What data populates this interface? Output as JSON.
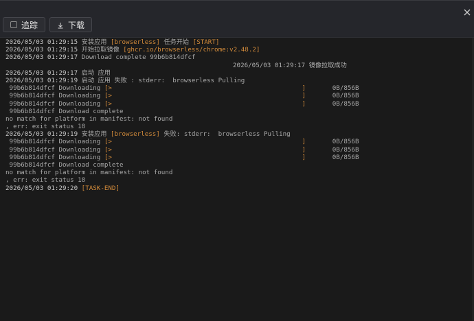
{
  "toolbar": {
    "follow_label": "追踪",
    "download_label": "下载"
  },
  "log": {
    "lines": [
      {
        "ts": "2026/05/03 01:29:15",
        "parts": [
          {
            "t": " 安装应用 ",
            "c": "msg"
          },
          {
            "t": "[browserless]",
            "c": "hl"
          },
          {
            "t": " 任务开始 ",
            "c": "msg"
          },
          {
            "t": "[START]",
            "c": "hl"
          }
        ]
      },
      {
        "ts": "2026/05/03 01:29:15",
        "parts": [
          {
            "t": " 开始拉取镜像 ",
            "c": "msg"
          },
          {
            "t": "[ghcr.io/browserless/chrome:v2.48.2]",
            "c": "hl"
          }
        ]
      },
      {
        "ts": "2026/05/03 01:29:17",
        "parts": [
          {
            "t": " Download complete 99b6b814dfcf",
            "c": "msg"
          }
        ]
      },
      {
        "right": "2026/05/03 01:29:17 镜像拉取成功"
      },
      {
        "ts": "2026/05/03 01:29:17",
        "parts": [
          {
            "t": " 启动 应用",
            "c": "msg"
          }
        ]
      },
      {
        "ts": "2026/05/03 01:29:19",
        "parts": [
          {
            "t": " 启动 应用 失败 : stderr:  browserless Pulling",
            "c": "msg"
          }
        ]
      },
      {
        "ts": "",
        "parts": [
          {
            "t": " 99b6b814dfcf Downloading ",
            "c": "msg"
          },
          {
            "t": "[>",
            "c": "hl"
          },
          {
            "t": "                                                  ",
            "c": "msg"
          },
          {
            "t": "]",
            "c": "hl"
          },
          {
            "t": "       0B/856B",
            "c": "msg"
          }
        ]
      },
      {
        "ts": "",
        "parts": [
          {
            "t": " 99b6b814dfcf Downloading ",
            "c": "msg"
          },
          {
            "t": "[>",
            "c": "hl"
          },
          {
            "t": "                                                  ",
            "c": "msg"
          },
          {
            "t": "]",
            "c": "hl"
          },
          {
            "t": "       0B/856B",
            "c": "msg"
          }
        ]
      },
      {
        "ts": "",
        "parts": [
          {
            "t": " 99b6b814dfcf Downloading ",
            "c": "msg"
          },
          {
            "t": "[>",
            "c": "hl"
          },
          {
            "t": "                                                  ",
            "c": "msg"
          },
          {
            "t": "]",
            "c": "hl"
          },
          {
            "t": "       0B/856B",
            "c": "msg"
          }
        ]
      },
      {
        "ts": "",
        "parts": [
          {
            "t": " 99b6b814dfcf Download complete",
            "c": "msg"
          }
        ]
      },
      {
        "ts": "",
        "parts": [
          {
            "t": "no match for platform in manifest: not found",
            "c": "msg"
          }
        ]
      },
      {
        "ts": "",
        "parts": [
          {
            "t": ", err: exit status 18",
            "c": "msg"
          }
        ]
      },
      {
        "ts": "2026/05/03 01:29:19",
        "parts": [
          {
            "t": " 安装应用 ",
            "c": "msg"
          },
          {
            "t": "[browserless]",
            "c": "hl"
          },
          {
            "t": " 失败: stderr:  browserless Pulling",
            "c": "msg"
          }
        ]
      },
      {
        "ts": "",
        "parts": [
          {
            "t": " 99b6b814dfcf Downloading ",
            "c": "msg"
          },
          {
            "t": "[>",
            "c": "hl"
          },
          {
            "t": "                                                  ",
            "c": "msg"
          },
          {
            "t": "]",
            "c": "hl"
          },
          {
            "t": "       0B/856B",
            "c": "msg"
          }
        ]
      },
      {
        "ts": "",
        "parts": [
          {
            "t": " 99b6b814dfcf Downloading ",
            "c": "msg"
          },
          {
            "t": "[>",
            "c": "hl"
          },
          {
            "t": "                                                  ",
            "c": "msg"
          },
          {
            "t": "]",
            "c": "hl"
          },
          {
            "t": "       0B/856B",
            "c": "msg"
          }
        ]
      },
      {
        "ts": "",
        "parts": [
          {
            "t": " 99b6b814dfcf Downloading ",
            "c": "msg"
          },
          {
            "t": "[>",
            "c": "hl"
          },
          {
            "t": "                                                  ",
            "c": "msg"
          },
          {
            "t": "]",
            "c": "hl"
          },
          {
            "t": "       0B/856B",
            "c": "msg"
          }
        ]
      },
      {
        "ts": "",
        "parts": [
          {
            "t": " 99b6b814dfcf Download complete",
            "c": "msg"
          }
        ]
      },
      {
        "ts": "",
        "parts": [
          {
            "t": "no match for platform in manifest: not found",
            "c": "msg"
          }
        ]
      },
      {
        "ts": "",
        "parts": [
          {
            "t": ", err: exit status 18",
            "c": "msg"
          }
        ]
      },
      {
        "ts": "2026/05/03 01:29:20",
        "parts": [
          {
            "t": " ",
            "c": "msg"
          },
          {
            "t": "[TASK-END]",
            "c": "hl"
          }
        ]
      }
    ]
  },
  "colors": {
    "highlight": "#d18a3a",
    "background": "#1a1a1a",
    "panel": "#25262b"
  },
  "icons": {
    "close": "close-icon",
    "follow": "checkbox-icon",
    "download": "download-icon"
  }
}
